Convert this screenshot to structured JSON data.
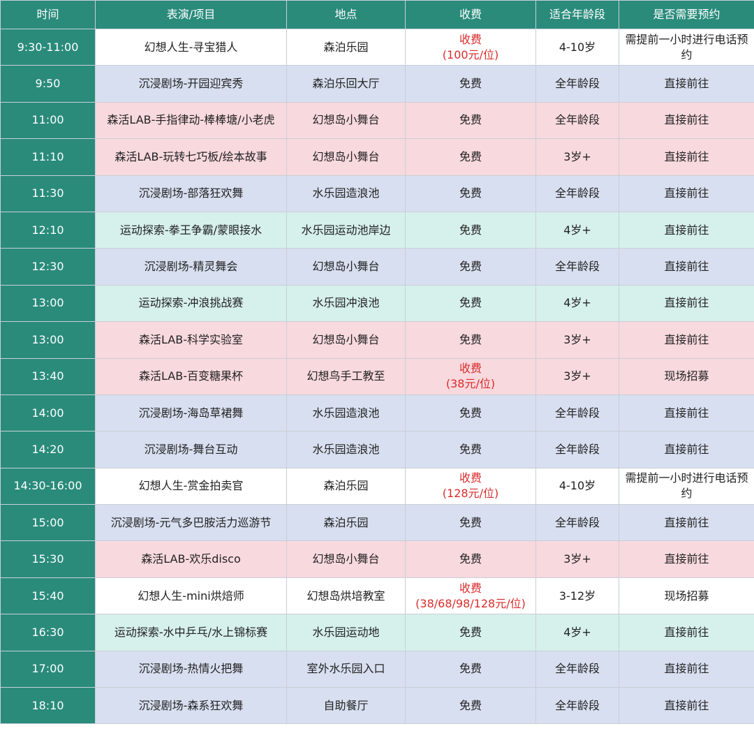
{
  "headers": [
    "时间",
    "表演/项目",
    "地点",
    "收费",
    "适合年龄段",
    "是否需要预约"
  ],
  "colors": {
    "header_bg": "#2a8b7b",
    "time_col_bg": "#2a8b7b",
    "row_white": "#ffffff",
    "row_blue": "#d8dff0",
    "row_pink": "#f8d9de",
    "row_green": "#d6f0ec",
    "paid_text": "#d92b2b"
  },
  "rows": [
    {
      "style": "w",
      "time": "9:30-11:00",
      "program": "幻想人生-寻宝猎人",
      "location": "森泊乐园",
      "fee": "收费",
      "fee_detail": "(100元/位)",
      "paid": true,
      "age": "4-10岁",
      "booking": "需提前一小时进行电话预约"
    },
    {
      "style": "b",
      "time": "9:50",
      "program": "沉浸剧场-开园迎宾秀",
      "location": "森泊乐回大厅",
      "fee": "免费",
      "fee_detail": "",
      "paid": false,
      "age": "全年龄段",
      "booking": "直接前往"
    },
    {
      "style": "p",
      "time": "11:00",
      "program": "森活LAB-手指律动-棒棒塘/小老虎",
      "location": "幻想岛小舞台",
      "fee": "免费",
      "fee_detail": "",
      "paid": false,
      "age": "全年龄段",
      "booking": "直接前往"
    },
    {
      "style": "p",
      "time": "11:10",
      "program": "森活LAB-玩转七巧板/绘本故事",
      "location": "幻想岛小舞台",
      "fee": "免费",
      "fee_detail": "",
      "paid": false,
      "age": "3岁+",
      "booking": "直接前往"
    },
    {
      "style": "b",
      "time": "11:30",
      "program": "沉浸剧场-部落狂欢舞",
      "location": "水乐园造浪池",
      "fee": "免费",
      "fee_detail": "",
      "paid": false,
      "age": "全年龄段",
      "booking": "直接前往"
    },
    {
      "style": "g",
      "time": "12:10",
      "program": "运动探索-拳王争霸/蒙眼接水",
      "location": "水乐园运动池岸边",
      "fee": "免费",
      "fee_detail": "",
      "paid": false,
      "age": "4岁+",
      "booking": "直接前往"
    },
    {
      "style": "b",
      "time": "12:30",
      "program": "沉浸剧场-精灵舞会",
      "location": "幻想岛小舞台",
      "fee": "免费",
      "fee_detail": "",
      "paid": false,
      "age": "全年龄段",
      "booking": "直接前往"
    },
    {
      "style": "g",
      "time": "13:00",
      "program": "运动探索-冲浪挑战赛",
      "location": "水乐园冲浪池",
      "fee": "免费",
      "fee_detail": "",
      "paid": false,
      "age": "4岁+",
      "booking": "直接前往"
    },
    {
      "style": "p",
      "time": "13:00",
      "program": "森活LAB-科学实验室",
      "location": "幻想岛小舞台",
      "fee": "免费",
      "fee_detail": "",
      "paid": false,
      "age": "3岁+",
      "booking": "直接前往"
    },
    {
      "style": "p",
      "time": "13:40",
      "program": "森活LAB-百变糖果杯",
      "location": "幻想鸟手工教至",
      "fee": "收费",
      "fee_detail": "(38元/位)",
      "paid": true,
      "age": "3岁+",
      "booking": "现场招募"
    },
    {
      "style": "b",
      "time": "14:00",
      "program": "沉浸剧场-海岛草裙舞",
      "location": "水乐园造浪池",
      "fee": "免费",
      "fee_detail": "",
      "paid": false,
      "age": "全年龄段",
      "booking": "直接前往"
    },
    {
      "style": "b",
      "time": "14:20",
      "program": "沉浸剧场-舞台互动",
      "location": "水乐园造浪池",
      "fee": "免费",
      "fee_detail": "",
      "paid": false,
      "age": "全年龄段",
      "booking": "直接前往"
    },
    {
      "style": "w",
      "time": "14:30-16:00",
      "program": "幻想人生-赏金拍卖官",
      "location": "森泊乐园",
      "fee": "收费",
      "fee_detail": "(128元/位)",
      "paid": true,
      "age": "4-10岁",
      "booking": "需提前一小时进行电话预约"
    },
    {
      "style": "b",
      "time": "15:00",
      "program": "沉浸剧场-元气多巴胺活力巡游节",
      "location": "森泊乐园",
      "fee": "免费",
      "fee_detail": "",
      "paid": false,
      "age": "全年龄段",
      "booking": "直接前往"
    },
    {
      "style": "p",
      "time": "15:30",
      "program": "森活LAB-欢乐disco",
      "location": "幻想岛小舞台",
      "fee": "免费",
      "fee_detail": "",
      "paid": false,
      "age": "3岁+",
      "booking": "直接前往"
    },
    {
      "style": "w",
      "time": "15:40",
      "program": "幻想人生-mini烘焙师",
      "location": "幻想岛烘培教室",
      "fee": "收费",
      "fee_detail": "(38/68/98/128元/位)",
      "paid": true,
      "age": "3-12岁",
      "booking": "现场招募"
    },
    {
      "style": "g",
      "time": "16:30",
      "program": "运动探索-水中乒乓/水上锦标赛",
      "location": "水乐园运动地",
      "fee": "免费",
      "fee_detail": "",
      "paid": false,
      "age": "4岁+",
      "booking": "直接前往"
    },
    {
      "style": "b",
      "time": "17:00",
      "program": "沉浸剧场-热情火把舞",
      "location": "室外水乐园入口",
      "fee": "免费",
      "fee_detail": "",
      "paid": false,
      "age": "全年龄段",
      "booking": "直接前往"
    },
    {
      "style": "b",
      "time": "18:10",
      "program": "沉浸剧场-森系狂欢舞",
      "location": "自助餐厅",
      "fee": "免费",
      "fee_detail": "",
      "paid": false,
      "age": "全年龄段",
      "booking": "直接前往"
    }
  ]
}
